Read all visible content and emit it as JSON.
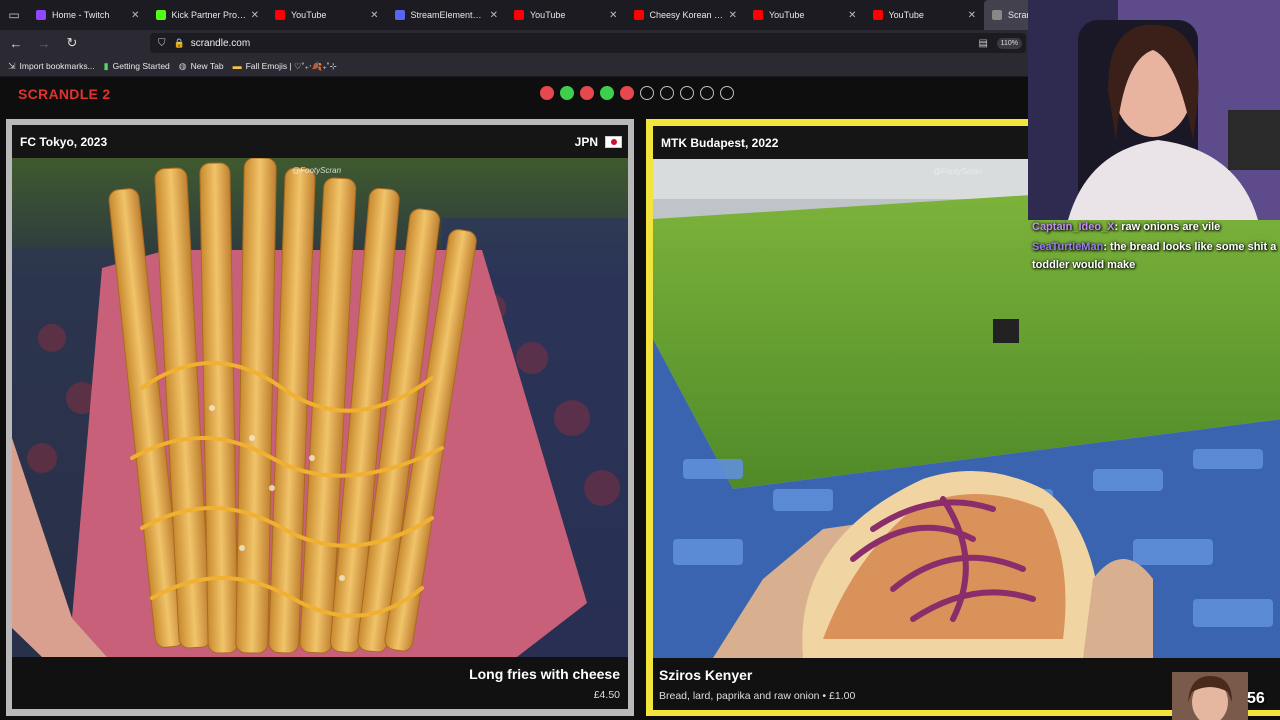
{
  "browser": {
    "tabs": [
      {
        "label": "Home - Twitch",
        "favicon_color": "#9146ff"
      },
      {
        "label": "Kick Partner Program -",
        "favicon_color": "#53fc18"
      },
      {
        "label": "YouTube",
        "favicon_color": "#ff0000"
      },
      {
        "label": "StreamElements - My c",
        "favicon_color": "#5865f2"
      },
      {
        "label": "YouTube",
        "favicon_color": "#ff0000"
      },
      {
        "label": "Cheesy Korean Egg Toa",
        "favicon_color": "#ff0000"
      },
      {
        "label": "YouTube",
        "favicon_color": "#ff0000"
      },
      {
        "label": "YouTube",
        "favicon_color": "#ff0000"
      },
      {
        "label": "Scran",
        "favicon_color": "#888888",
        "active": true
      }
    ],
    "url": "scrandle.com",
    "zoom": "110%",
    "bookmarks": [
      {
        "label": "Import bookmarks...",
        "icon": "import-icon"
      },
      {
        "label": "Getting Started",
        "icon": "getting-started-icon"
      },
      {
        "label": "New Tab",
        "icon": "globe-icon"
      },
      {
        "label": "Fall Emojis | ♡˚₊‧🍂₊˚⊹",
        "icon": "folder-icon"
      }
    ]
  },
  "game": {
    "logo": "SCRANDLE 2",
    "progress": [
      "red",
      "green",
      "red",
      "green",
      "red",
      "empty",
      "empty",
      "empty",
      "empty",
      "empty"
    ]
  },
  "cards": {
    "left": {
      "location": "FC Tokyo, 2023",
      "country": "JPN",
      "credit": "@FootyScran",
      "dish": "Long fries with cheese",
      "price": "£4.50"
    },
    "right": {
      "location": "MTK Budapest, 2022",
      "credit": "@FootyScran",
      "dish": "Sziros Kenyer",
      "description": "Bread, lard, paprika and raw onion • £1.00"
    }
  },
  "overlay": {
    "chat": [
      {
        "user": "Captain_Ideo_X",
        "message": "raw onions are vile"
      },
      {
        "user": "SeaTurtleMan",
        "message": "the bread looks like some shit a toddler would make"
      }
    ],
    "counter": "56"
  },
  "colors": {
    "logo": "#e0322e",
    "selected_border": "#f2e43c",
    "dot_red": "#e5484d",
    "dot_green": "#3ecf4e"
  }
}
